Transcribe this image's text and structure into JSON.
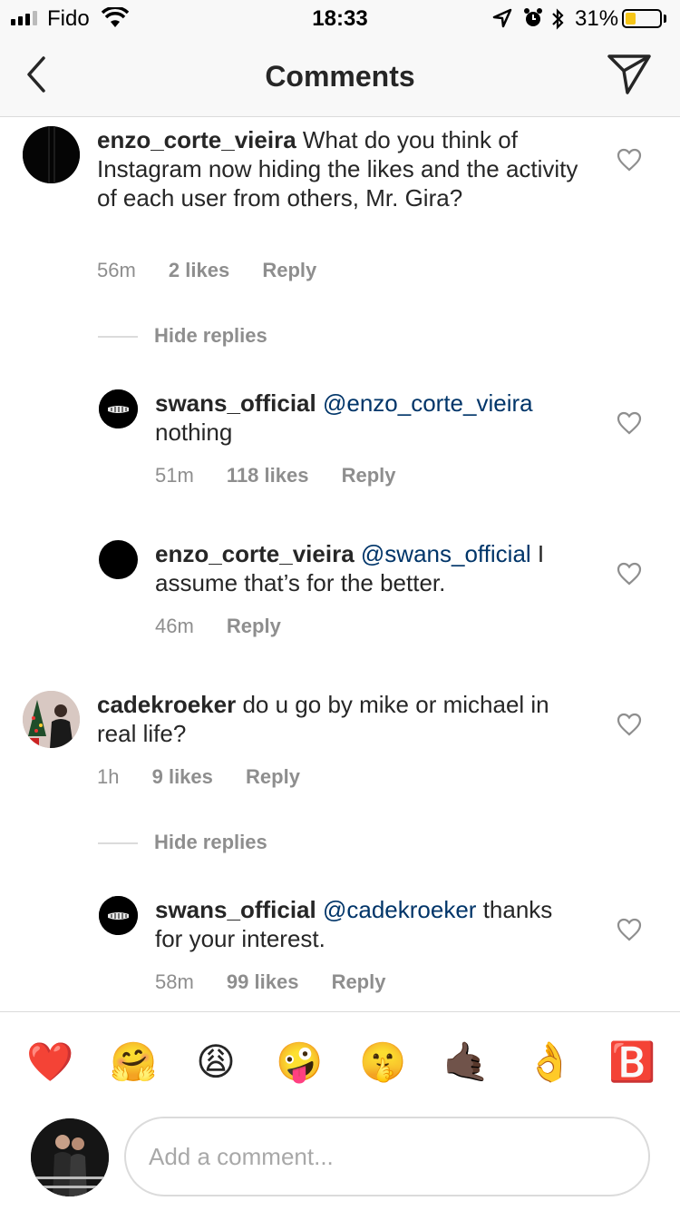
{
  "status_bar": {
    "carrier": "Fido",
    "time": "18:33",
    "battery_percent_label": "31%",
    "battery_level": 0.31
  },
  "header": {
    "title": "Comments"
  },
  "comments": [
    {
      "username": "enzo_corte_vieira",
      "text": "What do you think of Instagram now hiding the likes and the activity of each user from others, Mr. Gira?",
      "time": "56m",
      "likes": "2 likes",
      "reply_label": "Reply",
      "hide_replies_label": "Hide replies",
      "replies": [
        {
          "username": "swans_official",
          "mention": "@enzo_corte_vieira",
          "text": "nothing",
          "time": "51m",
          "likes": "118 likes",
          "reply_label": "Reply"
        },
        {
          "username": "enzo_corte_vieira",
          "mention": "@swans_official",
          "text": "I assume that’s for the better.",
          "time": "46m",
          "reply_label": "Reply"
        }
      ]
    },
    {
      "username": "cadekroeker",
      "text": "do u go by mike or michael in real life?",
      "time": "1h",
      "likes": "9 likes",
      "reply_label": "Reply",
      "hide_replies_label": "Hide replies",
      "replies": [
        {
          "username": "swans_official",
          "mention": "@cadekroeker",
          "text": "thanks for your interest.",
          "time": "58m",
          "likes": "99 likes",
          "reply_label": "Reply"
        }
      ]
    }
  ],
  "emoji_bar": [
    "❤️",
    "🤗",
    "😩",
    "🤪",
    "🤫",
    "🤙🏿",
    "👌",
    "🅱️"
  ],
  "input": {
    "placeholder": "Add a comment..."
  },
  "colors": {
    "mention": "#003569",
    "meta_gray": "#8e8e8e",
    "divider": "#dbdbdb",
    "battery_fill": "#f5c518"
  }
}
